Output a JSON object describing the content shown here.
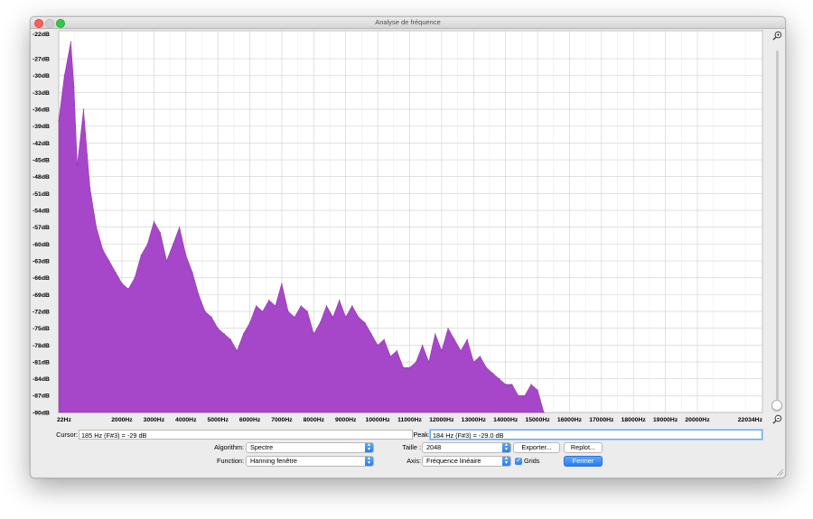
{
  "window": {
    "title": "Analyse de fréquence"
  },
  "chart_data": {
    "type": "area",
    "y_ticks": [
      "-22dB",
      "-27dB",
      "-30dB",
      "-33dB",
      "-36dB",
      "-39dB",
      "-42dB",
      "-45dB",
      "-48dB",
      "-51dB",
      "-54dB",
      "-57dB",
      "-60dB",
      "-63dB",
      "-66dB",
      "-69dB",
      "-72dB",
      "-75dB",
      "-78dB",
      "-81dB",
      "-84dB",
      "-87dB",
      "-90dB"
    ],
    "y_tick_values": [
      -22,
      -27,
      -30,
      -33,
      -36,
      -39,
      -42,
      -45,
      -48,
      -51,
      -54,
      -57,
      -60,
      -63,
      -66,
      -69,
      -72,
      -75,
      -78,
      -81,
      -84,
      -87,
      -90
    ],
    "x_ticks": [
      "22Hz",
      "2000Hz",
      "3000Hz",
      "4000Hz",
      "5000Hz",
      "6000Hz",
      "7000Hz",
      "8000Hz",
      "9000Hz",
      "10000Hz",
      "11000Hz",
      "12000Hz",
      "13000Hz",
      "14000Hz",
      "15000Hz",
      "16000Hz",
      "17000Hz",
      "18000Hz",
      "19000Hz",
      "20000Hz",
      "22034Hz"
    ],
    "x_tick_values": [
      22,
      2000,
      3000,
      4000,
      5000,
      6000,
      7000,
      8000,
      9000,
      10000,
      11000,
      12000,
      13000,
      14000,
      15000,
      16000,
      17000,
      18000,
      19000,
      20000,
      22034
    ],
    "xlim": [
      22,
      22034
    ],
    "ylim": [
      -90,
      -22
    ],
    "grid": true,
    "fill_color": "#a646c9",
    "series": [
      {
        "x": [
          22,
          200,
          400,
          500,
          600,
          800,
          1000,
          1200,
          1400,
          1600,
          1800,
          2000,
          2200,
          2400,
          2600,
          2800,
          3000,
          3200,
          3400,
          3600,
          3800,
          4000,
          4200,
          4400,
          4600,
          4800,
          5000,
          5200,
          5400,
          5600,
          5800,
          6000,
          6200,
          6400,
          6600,
          6800,
          7000,
          7200,
          7400,
          7600,
          7800,
          8000,
          8200,
          8400,
          8600,
          8800,
          9000,
          9200,
          9400,
          9600,
          9800,
          10000,
          10200,
          10400,
          10600,
          10800,
          11000,
          11200,
          11400,
          11600,
          11800,
          12000,
          12200,
          12400,
          12600,
          12800,
          13000,
          13200,
          13400,
          13600,
          13800,
          14000,
          14200,
          14400,
          14600,
          14800,
          15000,
          15200
        ],
        "values": [
          -38,
          -30,
          -24,
          -32,
          -46,
          -36,
          -50,
          -57,
          -61,
          -63,
          -65,
          -67,
          -68,
          -66,
          -62,
          -60,
          -56,
          -58,
          -63,
          -60,
          -57,
          -62,
          -65,
          -69,
          -72,
          -73,
          -75,
          -76,
          -77,
          -79,
          -76,
          -74,
          -71,
          -72,
          -70,
          -71,
          -67,
          -72,
          -73,
          -71,
          -72,
          -76,
          -74,
          -71,
          -73,
          -70,
          -73,
          -71,
          -73,
          -74,
          -76,
          -78,
          -77,
          -80,
          -79,
          -82,
          -82,
          -81,
          -78,
          -81,
          -76,
          -79,
          -75,
          -77,
          -79,
          -77,
          -81,
          -80,
          -82,
          -83,
          -84,
          -85,
          -85,
          -87,
          -87,
          -85,
          -86,
          -90
        ]
      }
    ]
  },
  "zoom": {
    "zoom_in_icon": "magnifier-plus-icon",
    "zoom_out_icon": "magnifier-minus-icon"
  },
  "cursor": {
    "label": "Cursor:",
    "value": "185 Hz (F#3) = -29 dB"
  },
  "peak": {
    "label": "Peak:",
    "value": "184 Hz (F#3) = -29.0 dB"
  },
  "controls": {
    "algorithm_label": "Algorithm:",
    "algorithm_value": "Spectre",
    "function_label": "Function:",
    "function_value": "Hanning fenêtre",
    "size_label": "Taille :",
    "size_value": "2048",
    "axis_label": "Axis:",
    "axis_value": "Fréquence linéaire",
    "grids_label": "Grids",
    "grids_checked": true,
    "export_label": "Exporter...",
    "replot_label": "Replot...",
    "close_label": "Fermer"
  }
}
